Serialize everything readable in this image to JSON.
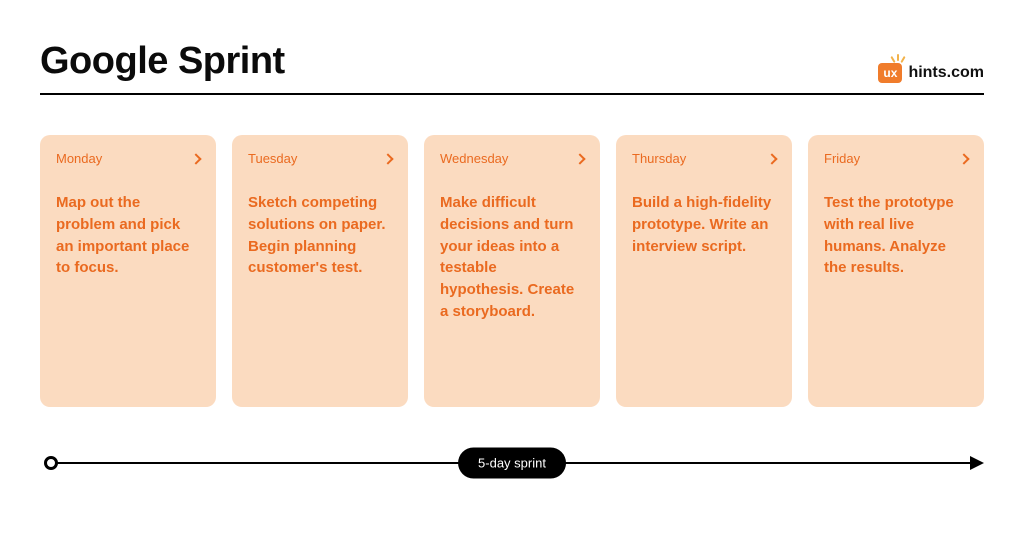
{
  "header": {
    "title": "Google Sprint",
    "brand_badge": "ux",
    "brand_text": "hints.com"
  },
  "days": [
    {
      "label": "Monday",
      "body": "Map out the problem and pick an important place to focus."
    },
    {
      "label": "Tuesday",
      "body": "Sketch competing solutions on paper. Begin planning customer's test."
    },
    {
      "label": "Wednesday",
      "body": "Make difficult decisions and turn your ideas into a testable hypothesis. Create a storyboard."
    },
    {
      "label": "Thursday",
      "body": "Build a high-fidelity prototype. Write an interview script."
    },
    {
      "label": "Friday",
      "body": "Test the prototype with real live humans. Analyze the results."
    }
  ],
  "timeline": {
    "label": "5-day sprint"
  }
}
